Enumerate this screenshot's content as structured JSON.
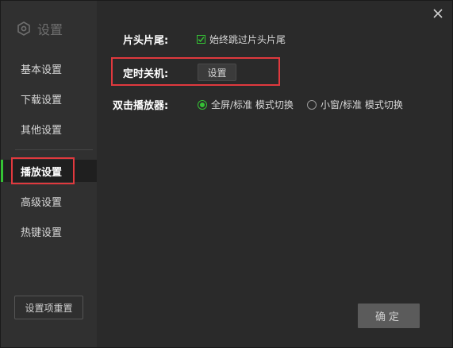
{
  "window": {
    "title": "设置"
  },
  "sidebar": {
    "items": [
      {
        "label": "基本设置",
        "active": false
      },
      {
        "label": "下载设置",
        "active": false
      },
      {
        "label": "其他设置",
        "active": false
      },
      {
        "label": "播放设置",
        "active": true
      },
      {
        "label": "高级设置",
        "active": false
      },
      {
        "label": "热键设置",
        "active": false
      }
    ],
    "reset_label": "设置项重置"
  },
  "settings": {
    "intro_outro": {
      "label": "片头片尾:",
      "checkbox_label": "始终跳过片头片尾",
      "checked": true
    },
    "timer_shutdown": {
      "label": "定时关机:",
      "button_label": "设置"
    },
    "double_click": {
      "label": "双击播放器:",
      "options": [
        {
          "label": "全屏/标准 模式切换",
          "checked": true
        },
        {
          "label": "小窗/标准 模式切换",
          "checked": false
        }
      ]
    }
  },
  "footer": {
    "ok_label": "确定"
  },
  "colors": {
    "accent": "#35c235",
    "highlight": "#e0393e",
    "background": "#2a2a2a",
    "sidebar": "#303030"
  },
  "icons": {
    "title": "settings-hexagon-icon",
    "close": "close-icon",
    "check": "checkmark-icon"
  }
}
